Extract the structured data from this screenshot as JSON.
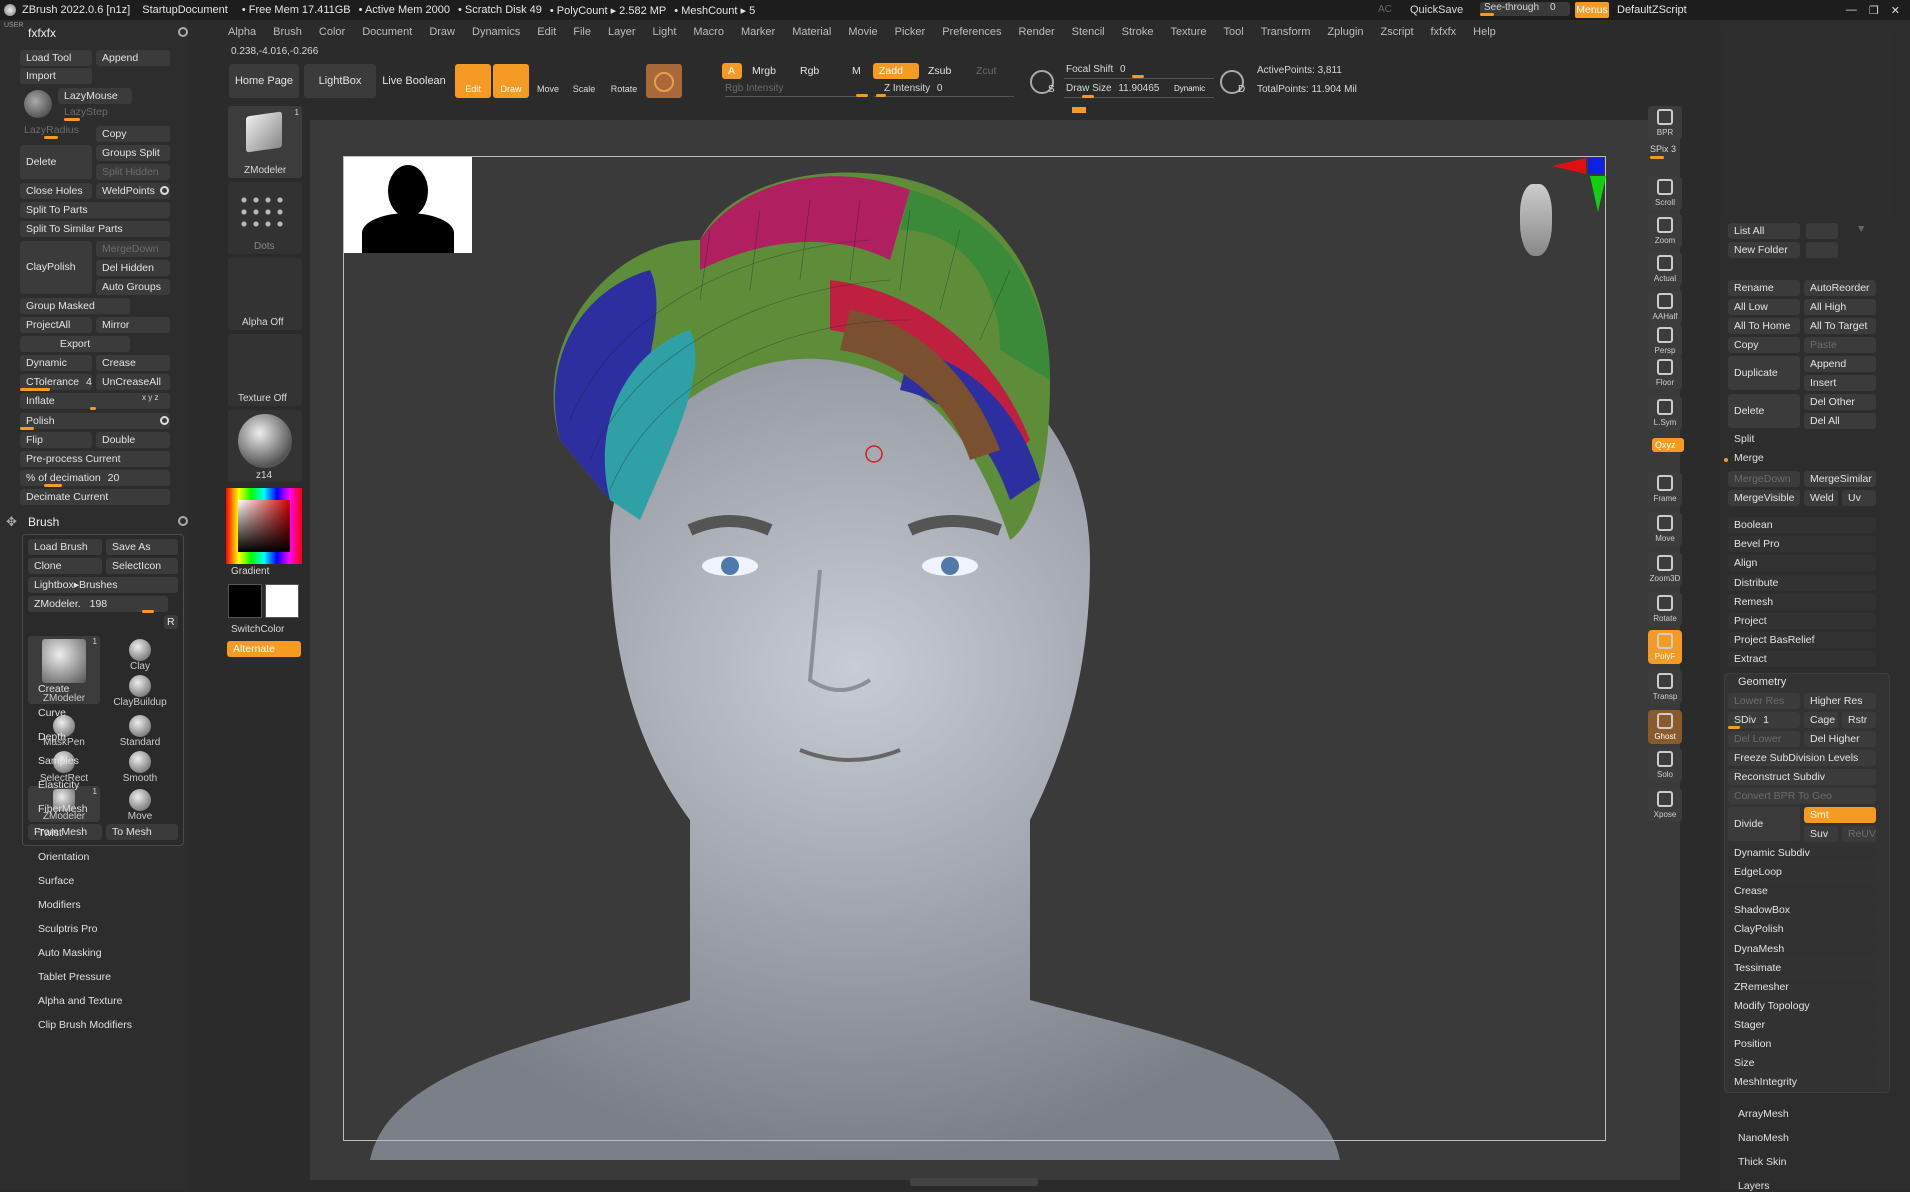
{
  "titlebar": {
    "app": "ZBrush 2022.0.6 [n1z]",
    "doc": "StartupDocument",
    "free_mem": "• Free Mem 17.411GB",
    "active_mem": "• Active Mem 2000",
    "scratch": "• Scratch Disk 49",
    "polycount": "• PolyCount ▸ 2.582 MP",
    "meshcount": "• MeshCount ▸ 5",
    "ac": "AC",
    "quicksave": "QuickSave",
    "seethrough": "See-through",
    "seethrough_val": "0",
    "menus": "Menus",
    "script": "DefaultZScript"
  },
  "menubar": [
    "Alpha",
    "Brush",
    "Color",
    "Document",
    "Draw",
    "Dynamics",
    "Edit",
    "File",
    "Layer",
    "Light",
    "Macro",
    "Marker",
    "Material",
    "Movie",
    "Picker",
    "Preferences",
    "Render",
    "Stencil",
    "Stroke",
    "Texture",
    "Tool",
    "Transform",
    "Zplugin",
    "Zscript",
    "fxfxfx",
    "Help"
  ],
  "coords": "0.238,-4.016,-0.266",
  "left": {
    "user": "USER",
    "title": "fxfxfx",
    "load_tool": "Load Tool",
    "append": "Append",
    "import": "Import",
    "lazymouse": "LazyMouse",
    "lazystep": "LazyStep",
    "lazyradius": "LazyRadius",
    "copy": "Copy",
    "delete": "Delete",
    "groups_split": "Groups Split",
    "split_hidden": "Split Hidden",
    "close_holes": "Close Holes",
    "weldpoints": "WeldPoints",
    "split_to_parts": "Split To Parts",
    "split_similar": "Split To Similar Parts",
    "claypolish": "ClayPolish",
    "mergedown": "MergeDown",
    "del_hidden": "Del Hidden",
    "auto_groups": "Auto Groups",
    "group_masked": "Group Masked",
    "projectall": "ProjectAll",
    "mirror": "Mirror",
    "export": "Export",
    "dynamic": "Dynamic",
    "crease": "Crease",
    "ctolerance": "CTolerance",
    "ctolerance_val": "45",
    "uncreaseall": "UnCreaseAll",
    "inflate": "Inflate",
    "inflate_xyz": "x y z",
    "polish": "Polish",
    "flip": "Flip",
    "double": "Double",
    "preprocess": "Pre-process Current",
    "decimation": "% of decimation",
    "decimation_val": "20",
    "decimate_current": "Decimate Current",
    "brush_title": "Brush",
    "load_brush": "Load Brush",
    "save_as": "Save As",
    "clone": "Clone",
    "select_icon": "SelectIcon",
    "lightbox_brushes": "Lightbox▸Brushes",
    "zmodeler_slider": "ZModeler.",
    "zmodeler_val": "198",
    "r": "R",
    "brushes": [
      {
        "name": "ZModeler",
        "count": "1"
      },
      {
        "name": "Clay"
      },
      {
        "name": "ClayBuildup"
      },
      {
        "name": "MaskPen"
      },
      {
        "name": "Standard"
      },
      {
        "name": "SelectRect"
      },
      {
        "name": "Smooth"
      },
      {
        "name": "ZModeler",
        "count": "1"
      },
      {
        "name": "Move"
      }
    ],
    "from_mesh": "From Mesh",
    "to_mesh": "To Mesh",
    "submenus": [
      "Create",
      "Curve",
      "Depth",
      "Samples",
      "Elasticity",
      "FiberMesh",
      "Twist",
      "Orientation",
      "Surface",
      "Modifiers",
      "Sculptris Pro",
      "Auto Masking",
      "Tablet Pressure",
      "Alpha and Texture",
      "Clip Brush Modifiers"
    ]
  },
  "toolcol": {
    "home": "Home Page",
    "lightbox": "LightBox",
    "live_boolean": "Live Boolean",
    "zmodeler": "ZModeler",
    "zmodeler_count": "1",
    "dots": "Dots",
    "alpha_off": "Alpha Off",
    "texture_off": "Texture Off",
    "material": "z14",
    "gradient": "Gradient",
    "switchcolor": "SwitchColor",
    "alternate": "Alternate"
  },
  "toolbar": {
    "edit": "Edit",
    "draw": "Draw",
    "move": "Move",
    "scale": "Scale",
    "rotate": "Rotate",
    "a": "A",
    "mrgb": "Mrgb",
    "rgb": "Rgb",
    "m": "M",
    "zadd": "Zadd",
    "zsub": "Zsub",
    "zcut": "Zcut",
    "rgb_intensity": "Rgb Intensity",
    "z_intensity": "Z Intensity",
    "z_intensity_val": "0",
    "focal_shift": "Focal Shift",
    "focal_val": "0",
    "draw_size": "Draw Size",
    "draw_size_val": "11.90465",
    "dynamic": "Dynamic",
    "active_points": "ActivePoints: 3,811",
    "total_points": "TotalPoints: 11.904 Mil",
    "s": "S",
    "d": "D"
  },
  "shelf": [
    "BPR",
    "SPix 3",
    "Scroll",
    "Zoom",
    "Actual",
    "AAHalf",
    "Persp",
    "Floor",
    "L.Sym",
    "",
    "Frame",
    "Move",
    "Zoom3D",
    "Rotate",
    "PolyF",
    "Transp",
    "Ghost",
    "Solo",
    "Xpose"
  ],
  "shelf_xyz": "Qxyz",
  "right": {
    "list_all": "List All",
    "new_folder": "New Folder",
    "rename": "Rename",
    "autoreorder": "AutoReorder",
    "all_low": "All Low",
    "all_high": "All High",
    "all_to_home": "All To Home",
    "all_to_target": "All To Target",
    "copy": "Copy",
    "paste": "Paste",
    "duplicate": "Duplicate",
    "append": "Append",
    "insert": "Insert",
    "delete": "Delete",
    "del_other": "Del Other",
    "del_all": "Del All",
    "split": "Split",
    "merge": "Merge",
    "mergedown": "MergeDown",
    "mergesimilar": "MergeSimilar",
    "mergevisible": "MergeVisible",
    "weld": "Weld",
    "uv": "Uv",
    "items": [
      "Boolean",
      "Bevel Pro",
      "Align",
      "Distribute",
      "Remesh",
      "Project",
      "Project BasRelief",
      "Extract"
    ],
    "geometry": "Geometry",
    "lower_res": "Lower Res",
    "higher_res": "Higher Res",
    "sdiv": "SDiv",
    "sdiv_val": "1",
    "cage": "Cage",
    "rstr": "Rstr",
    "del_lower": "Del Lower",
    "del_higher": "Del Higher",
    "freeze": "Freeze SubDivision Levels",
    "reconstruct": "Reconstruct Subdiv",
    "convert_bpr": "Convert BPR To Geo",
    "divide": "Divide",
    "smt": "Smt",
    "suv": "Suv",
    "reuv": "ReUV",
    "geo_items": [
      "Dynamic Subdiv",
      "EdgeLoop",
      "Crease",
      "ShadowBox",
      "ClayPolish",
      "DynaMesh",
      "Tessimate",
      "ZRemesher",
      "Modify Topology",
      "Stager",
      "Position",
      "Size",
      "MeshIntegrity"
    ],
    "bottom": [
      "ArrayMesh",
      "NanoMesh",
      "Thick Skin",
      "Layers"
    ]
  },
  "colors": {
    "accent": "#f59a23",
    "panel": "#2d2d2d",
    "button": "#3b3b3b"
  }
}
